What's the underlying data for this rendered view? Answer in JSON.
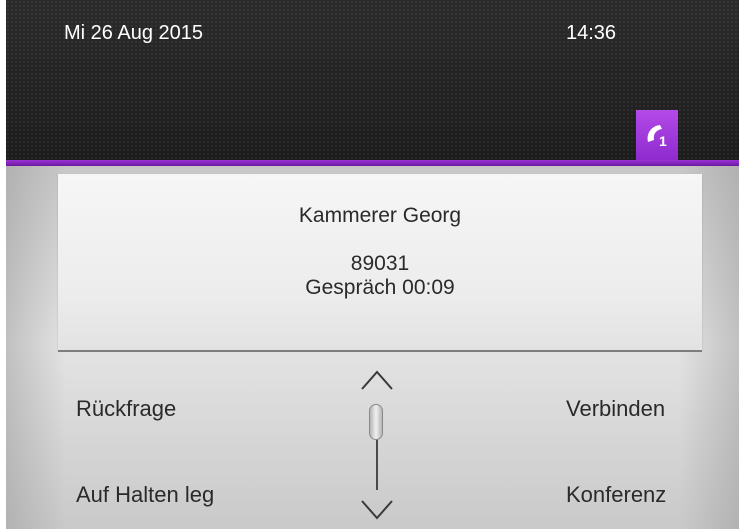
{
  "status_bar": {
    "date": "Mi 26 Aug 2015",
    "time": "14:36"
  },
  "call_tab": {
    "icon": "handset-one-icon",
    "accent_color": "#a43de0"
  },
  "call_info": {
    "name": "Kammerer Georg",
    "number": "89031",
    "status": "Gespräch 00:09"
  },
  "actions": {
    "left": [
      "Rückfrage",
      "Auf Halten leg"
    ],
    "right": [
      "Verbinden",
      "Konferenz"
    ]
  },
  "scroll": {
    "up_icon": "chevron-up-icon",
    "down_icon": "chevron-down-icon"
  }
}
